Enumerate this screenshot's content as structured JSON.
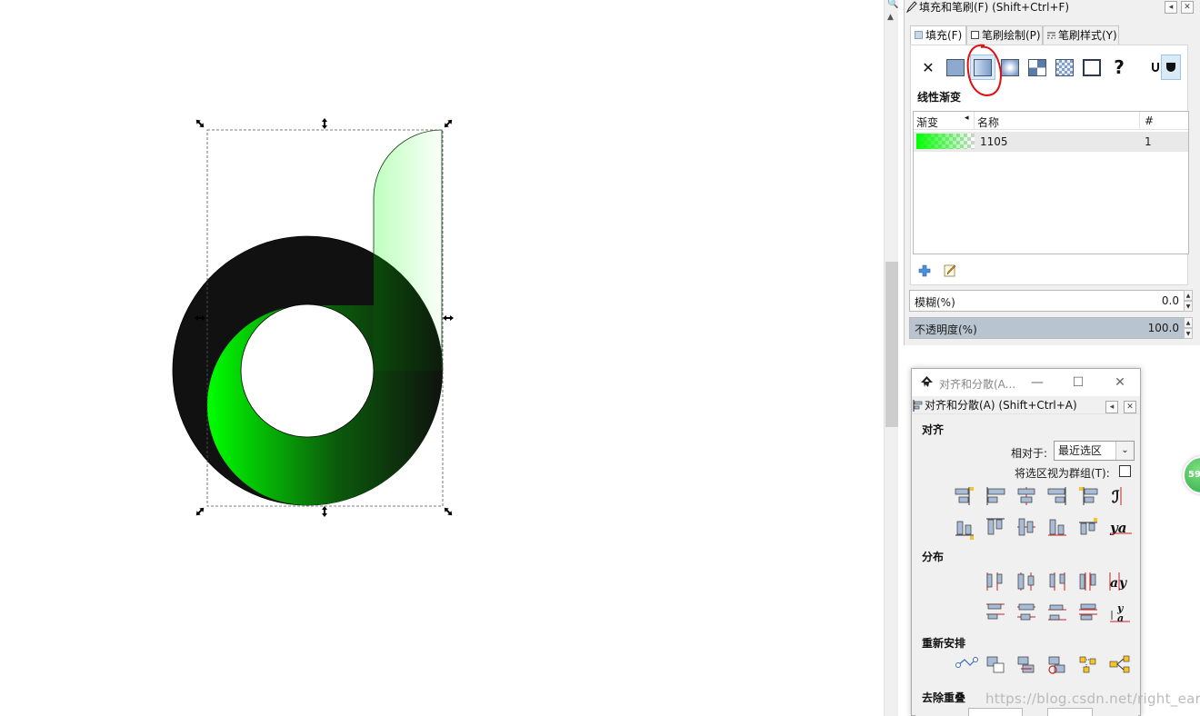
{
  "fill_stroke_dock": {
    "title": "填充和笔刷(F) (Shift+Ctrl+F)",
    "tabs": [
      {
        "label": "填充(F)"
      },
      {
        "label": "笔刷绘制(P)"
      },
      {
        "label": "笔刷样式(Y)"
      }
    ],
    "fill_types": [
      "no-paint",
      "flat-color",
      "linear-gradient",
      "radial-gradient",
      "pattern",
      "swatch",
      "unset",
      "unknown",
      "fill-rule-evenodd",
      "fill-rule-nonzero"
    ],
    "selected_fill_type": "linear-gradient",
    "mode_label": "线性渐变",
    "gradient_list": {
      "headers": {
        "gradient": "渐变",
        "name": "名称",
        "count": "#"
      },
      "rows": [
        {
          "name": "1105",
          "count": "1"
        }
      ]
    },
    "blur": {
      "label": "模糊(%)",
      "value": "0.0"
    },
    "opacity": {
      "label": "不透明度(%)",
      "value": "100.0"
    }
  },
  "align_window": {
    "window_title": "对齐和分散(A...",
    "panel_title": "对齐和分散(A) (Shift+Ctrl+A)",
    "sections": {
      "align": "对齐",
      "distribute": "分布",
      "rearrange": "重新安排",
      "remove_overlap": "去除重叠"
    },
    "relative_to_label": "相对于:",
    "relative_to_value": "最近选区",
    "treat_as_group_label": "将选区视为群组(T):"
  },
  "badge_text": "59",
  "watermark": "https://blog.csdn.net/right_earser",
  "colors": {
    "gradient_start": "#00ff00",
    "ring_dark": "#111111",
    "selection_dash": "#555555",
    "annotation_red": "#e01010"
  }
}
